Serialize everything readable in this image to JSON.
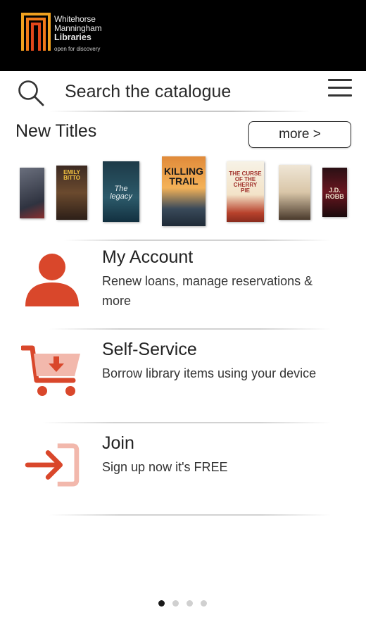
{
  "header": {
    "logo": {
      "line1": "Whitehorse",
      "line2": "Manningham",
      "line3": "Libraries",
      "tagline": "open for discovery"
    }
  },
  "search": {
    "placeholder": "Search the catalogue",
    "icon": "search-icon",
    "menu_icon": "hamburger-menu-icon"
  },
  "new_titles": {
    "heading": "New Titles",
    "more_label": "more >",
    "covers": [
      {
        "text": ""
      },
      {
        "text": "EMILY BITTO"
      },
      {
        "text": "The legacy"
      },
      {
        "text": "KILLING TRAIL"
      },
      {
        "text": "THE CURSE OF THE CHERRY PIE"
      },
      {
        "text": ""
      },
      {
        "text": "J.D. ROBB"
      }
    ]
  },
  "menu": [
    {
      "title": "My Account",
      "description": "Renew loans, manage reservations & more",
      "icon": "user-icon"
    },
    {
      "title": "Self-Service",
      "description": "Borrow library items using your device",
      "icon": "cart-icon"
    },
    {
      "title": "Join",
      "description": "Sign up now it's FREE",
      "icon": "sign-in-icon"
    }
  ],
  "pager": {
    "pages": 4,
    "active": 1
  },
  "colors": {
    "accent": "#d9472b",
    "accent_light": "#f2b8ac",
    "header_bg": "#000000"
  }
}
